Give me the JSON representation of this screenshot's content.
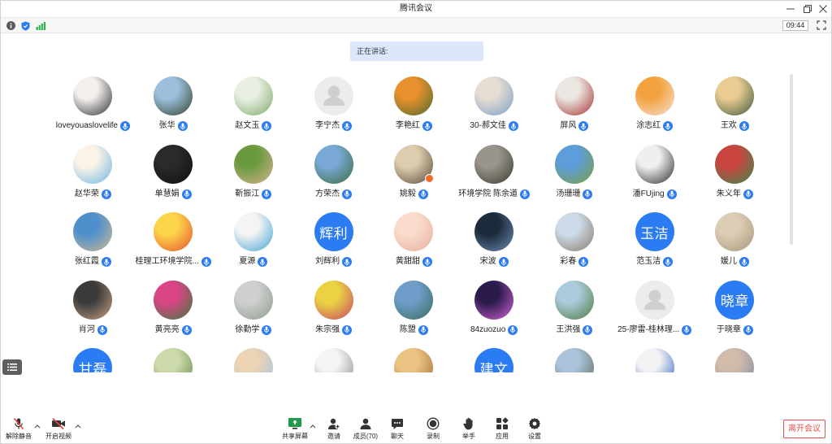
{
  "window": {
    "title": "腾讯会议",
    "controls": [
      "minimize-icon",
      "restore-icon",
      "close-icon"
    ]
  },
  "statusbar": {
    "icons": [
      "info-icon",
      "shield-icon",
      "signal-icon"
    ],
    "timer": "09:44",
    "fullscreen_icon": "fullscreen-icon"
  },
  "speaking": {
    "label": "正在讲话:"
  },
  "colors": {
    "accent": "#2b7bf3",
    "banner_bg": "#dbe8fb",
    "muted_red": "#e5463e",
    "leave_red": "#e8504c",
    "share_green": "#1f9a48",
    "default_avatar_bg": "#ececec",
    "default_avatar_fg": "#cfcfcf"
  },
  "participants": [
    {
      "name": "loveyouaslovelife",
      "avatar": "photo",
      "colors": [
        "#f2efec",
        "#2e2e33"
      ]
    },
    {
      "name": "张华",
      "avatar": "photo",
      "colors": [
        "#9cc0dc",
        "#33412f"
      ]
    },
    {
      "name": "赵文玉",
      "avatar": "photo",
      "colors": [
        "#e9efe2",
        "#7fa86a"
      ]
    },
    {
      "name": "李宁杰",
      "avatar": "default"
    },
    {
      "name": "李艳红",
      "avatar": "photo",
      "colors": [
        "#e8902e",
        "#4e6b2c"
      ]
    },
    {
      "name": "30-郝文佳",
      "avatar": "photo",
      "colors": [
        "#e4ddd2",
        "#7e9fc8"
      ]
    },
    {
      "name": "屏风",
      "avatar": "photo",
      "colors": [
        "#eae6e2",
        "#a8322e"
      ]
    },
    {
      "name": "涂志红",
      "avatar": "photo",
      "colors": [
        "#f3a23f",
        "#f4e2d4"
      ]
    },
    {
      "name": "王欢",
      "avatar": "photo",
      "colors": [
        "#eacb92",
        "#3d5b3e"
      ]
    },
    {
      "name": "赵华荣",
      "avatar": "photo",
      "colors": [
        "#fbf3e6",
        "#6cb6e4"
      ]
    },
    {
      "name": "单慧娟",
      "avatar": "photo",
      "colors": [
        "#2a2a2a",
        "#0f0f0f"
      ]
    },
    {
      "name": "靳振江",
      "avatar": "photo",
      "colors": [
        "#6b9a3e",
        "#d8b393"
      ]
    },
    {
      "name": "方荣杰",
      "avatar": "photo",
      "colors": [
        "#79a8d6",
        "#3c6b40"
      ]
    },
    {
      "name": "姚毅",
      "avatar": "photo",
      "colors": [
        "#ddcdb0",
        "#5c4b3a"
      ],
      "badge_color": "#f26b2a"
    },
    {
      "name": "环境学院 陈余道",
      "avatar": "photo",
      "colors": [
        "#9a958c",
        "#3b3a2c"
      ]
    },
    {
      "name": "汤珊珊",
      "avatar": "photo",
      "colors": [
        "#5e9cda",
        "#7aa23c"
      ]
    },
    {
      "name": "潘FUjing",
      "avatar": "photo",
      "colors": [
        "#efefef",
        "#2c2c2c"
      ]
    },
    {
      "name": "朱义年",
      "avatar": "photo",
      "colors": [
        "#c8453f",
        "#3d8b4b"
      ]
    },
    {
      "name": "张红霞",
      "avatar": "photo",
      "colors": [
        "#4f8fcc",
        "#cdbb92"
      ]
    },
    {
      "name": "桂理工环境学院...",
      "avatar": "photo",
      "colors": [
        "#fbd54a",
        "#e8522f"
      ]
    },
    {
      "name": "夏源",
      "avatar": "photo",
      "colors": [
        "#f4f4f4",
        "#41a3d3"
      ]
    },
    {
      "name": "刘辉利",
      "avatar": "text",
      "avatar_text": "辉利"
    },
    {
      "name": "黄甜甜",
      "avatar": "photo",
      "colors": [
        "#f9dccc",
        "#e6ae9c"
      ]
    },
    {
      "name": "宋波",
      "avatar": "photo",
      "colors": [
        "#1c2b3b",
        "#6b8cb3"
      ]
    },
    {
      "name": "彩春",
      "avatar": "photo",
      "colors": [
        "#cddbe9",
        "#8a7b6b"
      ]
    },
    {
      "name": "范玉洁",
      "avatar": "text",
      "avatar_text": "玉洁"
    },
    {
      "name": "媛儿",
      "avatar": "photo",
      "colors": [
        "#dccdb5",
        "#a7977a"
      ]
    },
    {
      "name": "肖河",
      "avatar": "photo",
      "colors": [
        "#3b3b3b",
        "#c9a283"
      ]
    },
    {
      "name": "黄亮亮",
      "avatar": "photo",
      "colors": [
        "#da4585",
        "#3b7b3c"
      ]
    },
    {
      "name": "徐勤学",
      "avatar": "photo",
      "colors": [
        "#cfcfcf",
        "#8b9b8b"
      ]
    },
    {
      "name": "朱宗强",
      "avatar": "photo",
      "colors": [
        "#ead244",
        "#c94463"
      ]
    },
    {
      "name": "陈盟",
      "avatar": "photo",
      "colors": [
        "#6e9dca",
        "#3b6b5b"
      ]
    },
    {
      "name": "84zuozuo",
      "avatar": "photo",
      "colors": [
        "#2b1b4c",
        "#d564d4"
      ]
    },
    {
      "name": "王洪强",
      "avatar": "photo",
      "colors": [
        "#abcadb",
        "#4b7b3c"
      ]
    },
    {
      "name": "25-廖雷-桂林理...",
      "avatar": "default"
    },
    {
      "name": "于晓章",
      "avatar": "text",
      "avatar_text": "晓章"
    },
    {
      "avatar": "text",
      "avatar_text": "甘磊"
    },
    {
      "avatar": "photo",
      "colors": [
        "#cddbab",
        "#6b8b4b"
      ]
    },
    {
      "avatar": "photo",
      "colors": [
        "#ebd3b3",
        "#a3c3e3"
      ]
    },
    {
      "avatar": "photo",
      "colors": [
        "#f4f4f4",
        "#8c8c8c"
      ]
    },
    {
      "avatar": "photo",
      "colors": [
        "#ebc383",
        "#a36b33"
      ]
    },
    {
      "avatar": "text",
      "avatar_text": "建文"
    },
    {
      "avatar": "photo",
      "colors": [
        "#abc3db",
        "#5b6b5b"
      ]
    },
    {
      "avatar": "photo",
      "colors": [
        "#f3f3f3",
        "#3363c3"
      ]
    },
    {
      "avatar": "photo",
      "colors": [
        "#d3bbab",
        "#7b8ba3"
      ]
    }
  ],
  "toolbar": {
    "left": [
      {
        "label": "解除静音",
        "icon": "mic-muted-icon"
      },
      {
        "label": "开启视频",
        "icon": "video-off-icon"
      }
    ],
    "center": [
      {
        "label": "共享屏幕",
        "icon": "share-screen-icon"
      },
      {
        "label": "邀请",
        "icon": "invite-icon"
      },
      {
        "label": "成员(70)",
        "icon": "members-icon"
      },
      {
        "label": "聊天",
        "icon": "chat-icon"
      },
      {
        "label": "录制",
        "icon": "record-icon"
      },
      {
        "label": "举手",
        "icon": "raise-hand-icon"
      },
      {
        "label": "应用",
        "icon": "apps-icon"
      },
      {
        "label": "设置",
        "icon": "settings-icon"
      }
    ],
    "leave_label": "离开会议"
  }
}
